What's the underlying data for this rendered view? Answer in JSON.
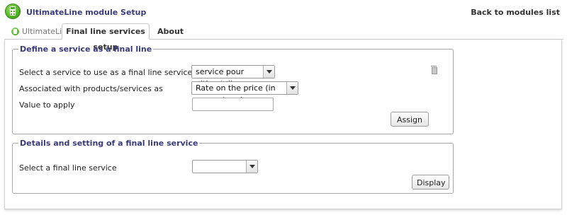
{
  "header": {
    "app_title": "UltimateLine module Setup",
    "back_link": "Back to modules list",
    "app_icon": "calculator-icon"
  },
  "tabs": [
    {
      "label": "UltimateLine",
      "icon": "calculator-icon",
      "active": false
    },
    {
      "label": "Final line services setup",
      "active": true
    },
    {
      "label": "About",
      "active": false
    }
  ],
  "define_section": {
    "legend": "Define a service as a final line",
    "service_label": "Select a service to use as a final line service",
    "service_value": "service pour ultimateline",
    "association_label": "Associated with products/services as",
    "association_value": "Rate on the price (in percentage)",
    "value_label": "Value to apply",
    "value_input": "",
    "assign_button": "Assign",
    "delete_icon": "trash-icon"
  },
  "details_section": {
    "legend": "Details and setting of a final line service",
    "select_label": "Select a final line service",
    "select_value": "",
    "display_button": "Display"
  },
  "colors": {
    "legend_text": "#3a3a7a",
    "brand_green": "#4cae22"
  }
}
